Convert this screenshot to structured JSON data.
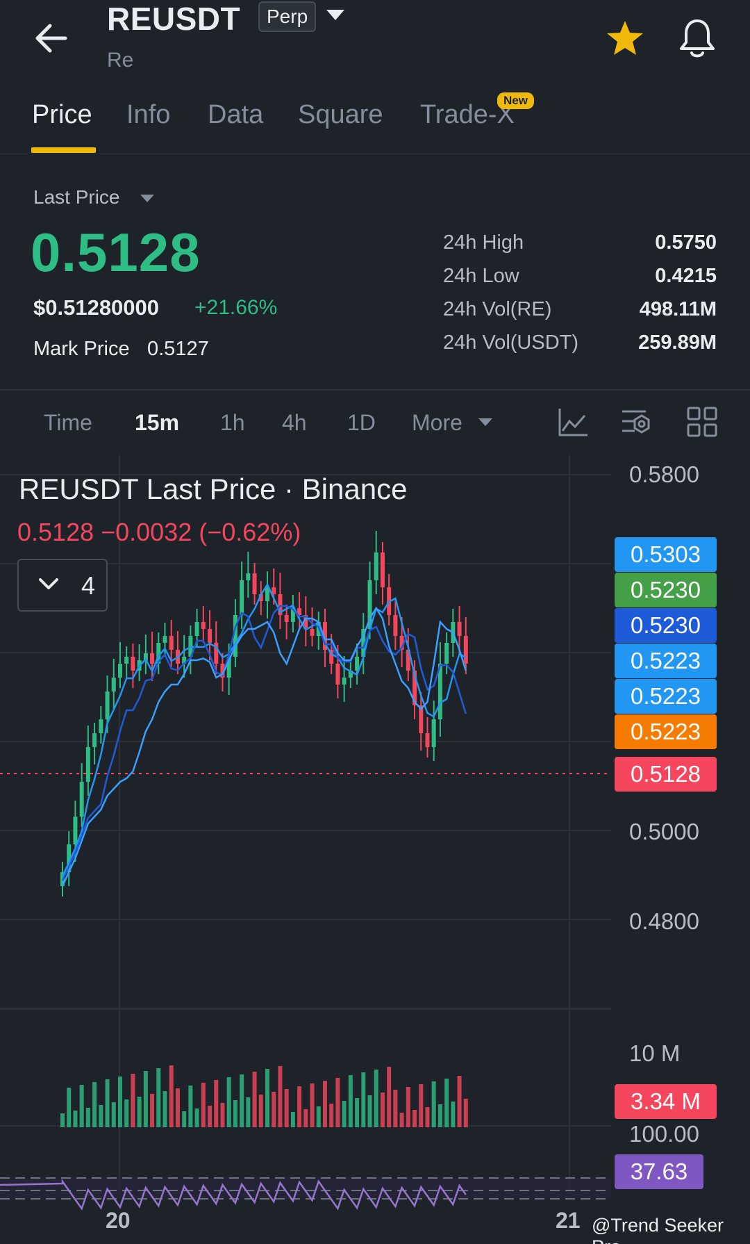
{
  "header": {
    "symbol": "REUSDT",
    "contract_type": "Perp",
    "base_name": "Re"
  },
  "tabs": [
    {
      "label": "Price"
    },
    {
      "label": "Info"
    },
    {
      "label": "Data"
    },
    {
      "label": "Square"
    },
    {
      "label": "Trade-X"
    }
  ],
  "new_badge": "New",
  "price_panel": {
    "last_price_label": "Last Price",
    "last_price": "0.5128",
    "usd_price": "$0.51280000",
    "change_pct": "+21.66%",
    "mark_price_label": "Mark Price",
    "mark_price": "0.5127",
    "stats": [
      {
        "label": "24h High",
        "value": "0.5750"
      },
      {
        "label": "24h Low",
        "value": "0.4215"
      },
      {
        "label": "24h Vol(RE)",
        "value": "498.11M"
      },
      {
        "label": "24h Vol(USDT)",
        "value": "259.89M"
      }
    ]
  },
  "intervals": [
    "Time",
    "15m",
    "1h",
    "4h",
    "1D",
    "More"
  ],
  "selected_interval": "15m",
  "chart_header": {
    "title": "REUSDT Last Price · Binance",
    "subtitle": "0.5128  −0.0032 (−0.62%)",
    "indicator_count": "4"
  },
  "chart_data": {
    "type": "candlestick",
    "price_axis_labels": [
      "0.5800",
      "0.5000",
      "0.4800"
    ],
    "price_tags": [
      {
        "value": "0.5303",
        "color": "#2196f3"
      },
      {
        "value": "0.5230",
        "color": "#43a047"
      },
      {
        "value": "0.5230",
        "color": "#1e5bd8"
      },
      {
        "value": "0.5223",
        "color": "#2196f3"
      },
      {
        "value": "0.5223",
        "color": "#2196f3"
      },
      {
        "value": "0.5223",
        "color": "#f57c00"
      },
      {
        "value": "0.5128",
        "color": "#f6465d"
      }
    ],
    "volume_axis_label": "10 M",
    "volume_tag": "3.34 M",
    "rsi_axis_label": "100.00",
    "rsi_tag": "37.63",
    "x_labels": [
      "20",
      "21"
    ],
    "up_color": "#2ebd85",
    "down_color": "#f6465d"
  },
  "watermark": "@Trend Seeker Pro"
}
